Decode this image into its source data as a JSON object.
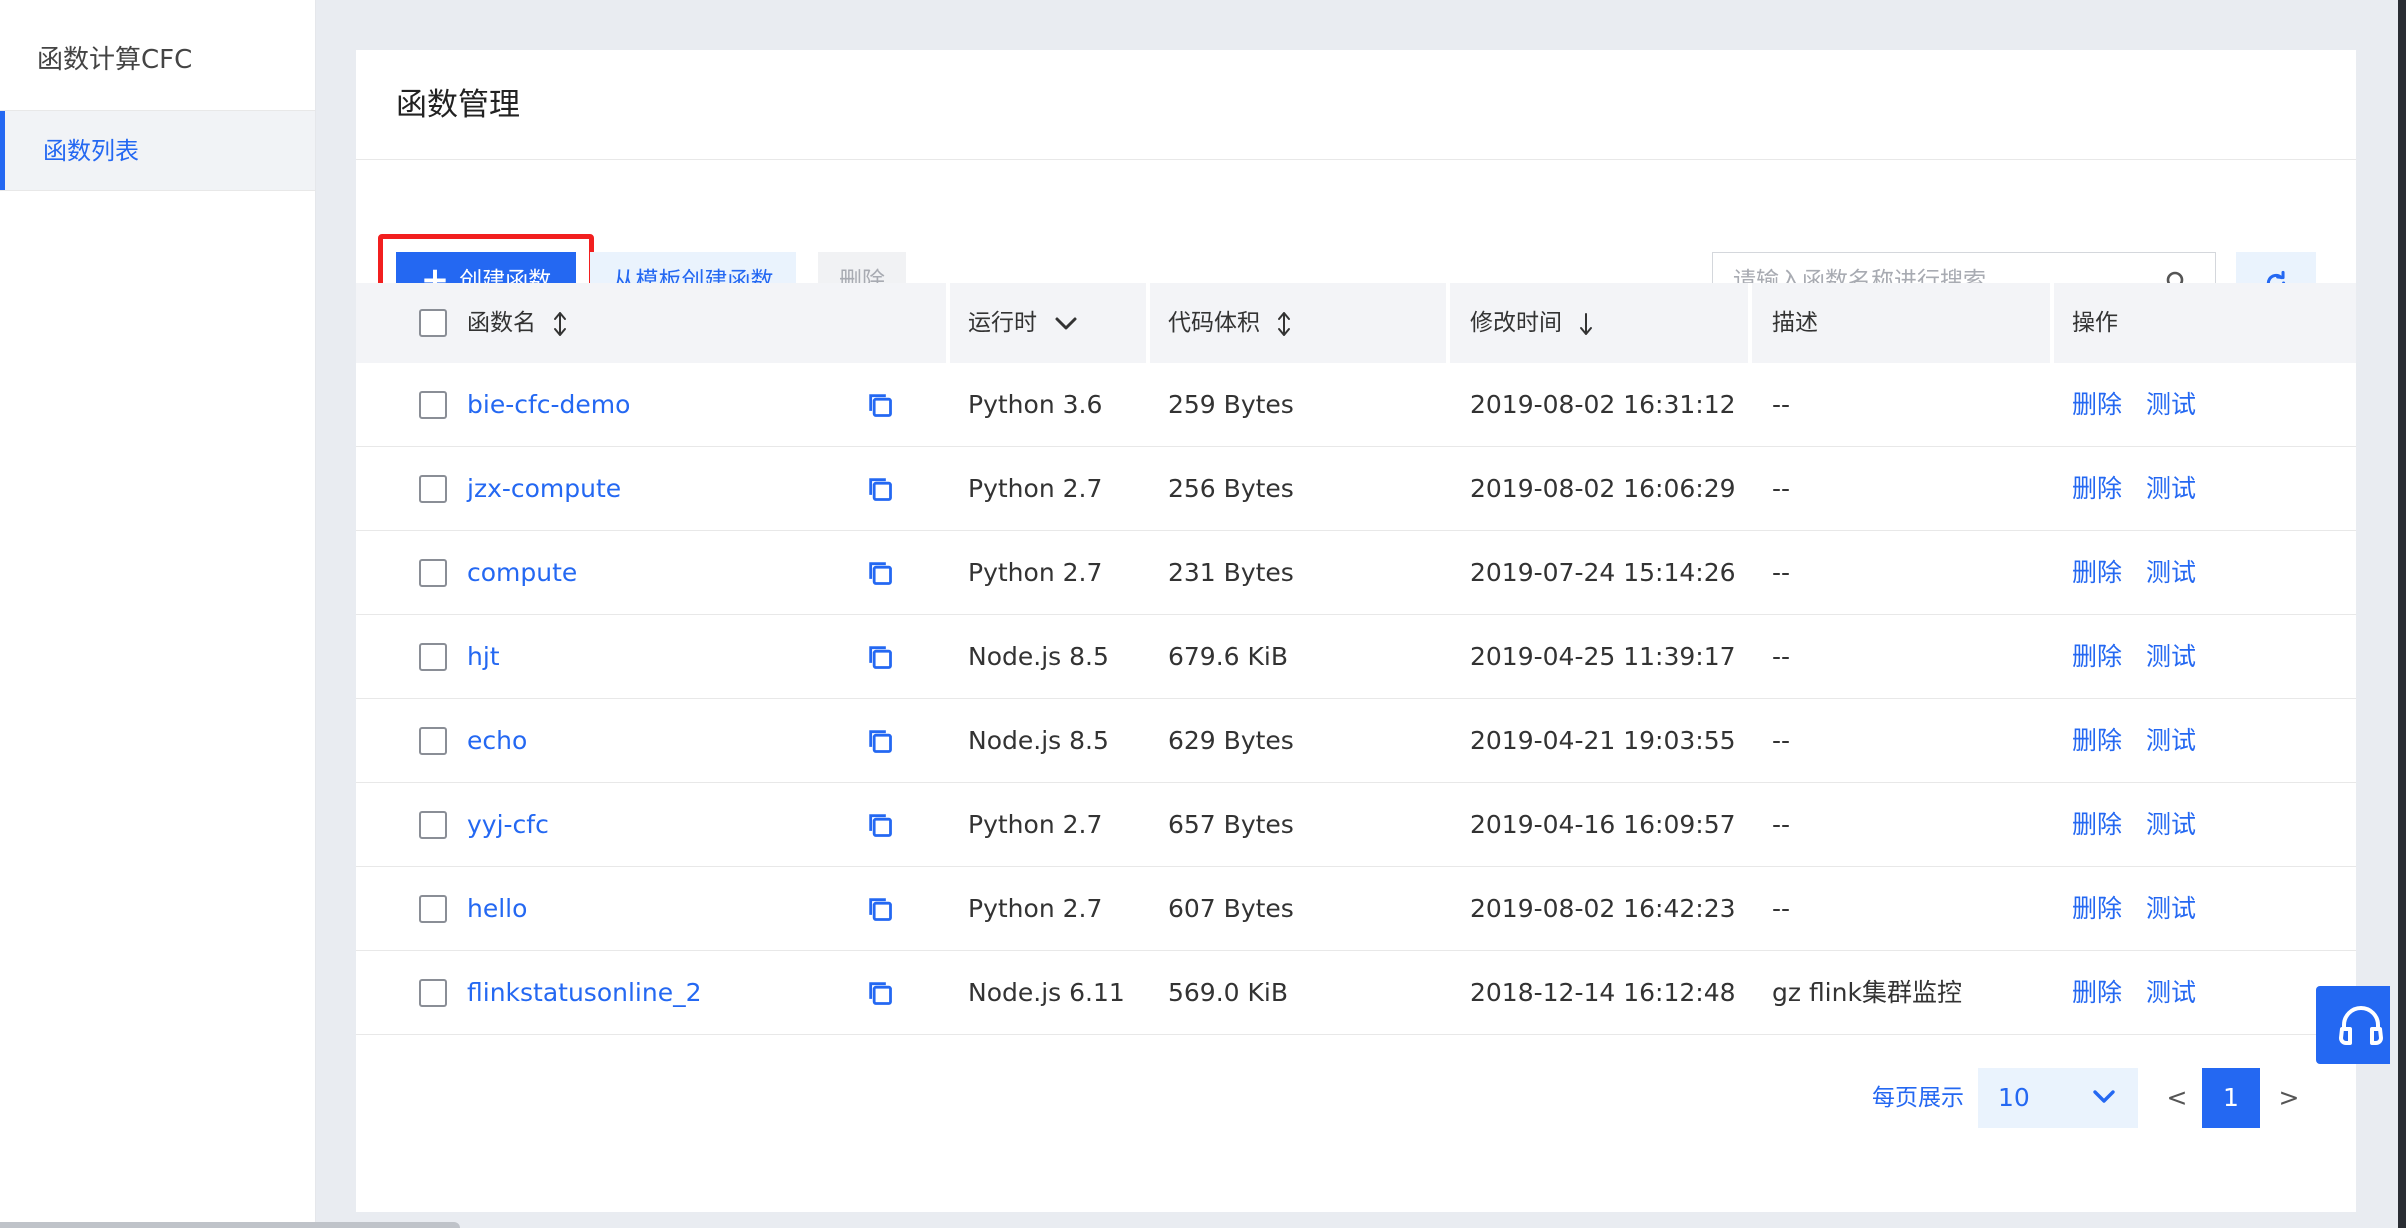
{
  "app": {
    "title": "函数计算CFC"
  },
  "sidebar": {
    "items": [
      {
        "label": "函数列表"
      }
    ]
  },
  "page": {
    "title": "函数管理"
  },
  "toolbar": {
    "create_label": "创建函数",
    "template_label": "从模板创建函数",
    "delete_label": "删除",
    "search_placeholder": "请输入函数名称进行搜索"
  },
  "table": {
    "headers": {
      "name": "函数名",
      "runtime": "运行时",
      "size": "代码体积",
      "modified": "修改时间",
      "desc": "描述",
      "ops": "操作"
    },
    "rows": [
      {
        "name": "bie-cfc-demo",
        "runtime": "Python 3.6",
        "size": "259 Bytes",
        "modified": "2019-08-02 16:31:12",
        "desc": "--",
        "op_delete": "删除",
        "op_test": "测试"
      },
      {
        "name": "jzx-compute",
        "runtime": "Python 2.7",
        "size": "256 Bytes",
        "modified": "2019-08-02 16:06:29",
        "desc": "--",
        "op_delete": "删除",
        "op_test": "测试"
      },
      {
        "name": "compute",
        "runtime": "Python 2.7",
        "size": "231 Bytes",
        "modified": "2019-07-24 15:14:26",
        "desc": "--",
        "op_delete": "删除",
        "op_test": "测试"
      },
      {
        "name": "hjt",
        "runtime": "Node.js 8.5",
        "size": "679.6 KiB",
        "modified": "2019-04-25 11:39:17",
        "desc": "--",
        "op_delete": "删除",
        "op_test": "测试"
      },
      {
        "name": "echo",
        "runtime": "Node.js 8.5",
        "size": "629 Bytes",
        "modified": "2019-04-21 19:03:55",
        "desc": "--",
        "op_delete": "删除",
        "op_test": "测试"
      },
      {
        "name": "yyj-cfc",
        "runtime": "Python 2.7",
        "size": "657 Bytes",
        "modified": "2019-04-16 16:09:57",
        "desc": "--",
        "op_delete": "删除",
        "op_test": "测试"
      },
      {
        "name": "hello",
        "runtime": "Python 2.7",
        "size": "607 Bytes",
        "modified": "2019-08-02 16:42:23",
        "desc": "--",
        "op_delete": "删除",
        "op_test": "测试"
      },
      {
        "name": "flinkstatusonline_2",
        "runtime": "Node.js 6.11",
        "size": "569.0 KiB",
        "modified": "2018-12-14 16:12:48",
        "desc": "gz flink集群监控",
        "op_delete": "删除",
        "op_test": "测试"
      }
    ]
  },
  "pagination": {
    "per_page_label": "每页展示",
    "page_size": "10",
    "prev": "<",
    "current_page": "1",
    "next": ">"
  },
  "colors": {
    "accent": "#2468f2",
    "highlight": "#f21f1f"
  },
  "icons": [
    "plus-icon",
    "search-icon",
    "refresh-icon",
    "sort-icon",
    "chevron-down-icon",
    "arrow-down-icon",
    "copy-icon",
    "headset-icon"
  ]
}
